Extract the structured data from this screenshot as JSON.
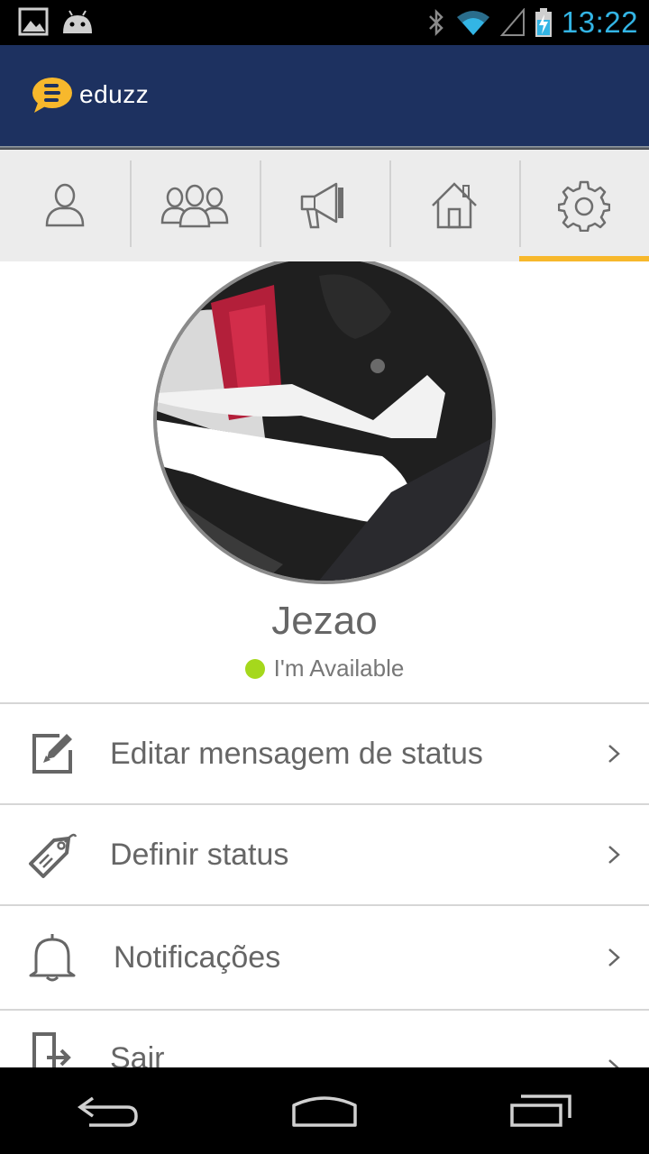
{
  "statusbar": {
    "time": "13:22",
    "left_icons": [
      "image-notification-icon",
      "android-notification-icon"
    ],
    "right_icons": [
      "bluetooth-icon",
      "wifi-icon",
      "signal-icon",
      "battery-charging-icon"
    ]
  },
  "app": {
    "brand": "eduzz"
  },
  "tabs": [
    {
      "icon": "person-icon",
      "active": false
    },
    {
      "icon": "group-icon",
      "active": false
    },
    {
      "icon": "megaphone-icon",
      "active": false
    },
    {
      "icon": "home-icon",
      "active": false
    },
    {
      "icon": "gear-icon",
      "active": true
    }
  ],
  "profile": {
    "name": "Jezao",
    "status_text": "I'm Available",
    "status_color": "#a5d81c"
  },
  "menu": {
    "items": [
      {
        "label": "Editar mensagem de status",
        "icon": "edit-icon"
      },
      {
        "label": "Definir status",
        "icon": "tag-icon"
      },
      {
        "label": "Notificações",
        "icon": "bell-icon"
      },
      {
        "label": "Sair",
        "icon": "exit-icon"
      }
    ]
  },
  "colors": {
    "actionbar": "#1d3160",
    "accent": "#f7b82c",
    "clock": "#33b5e5"
  }
}
